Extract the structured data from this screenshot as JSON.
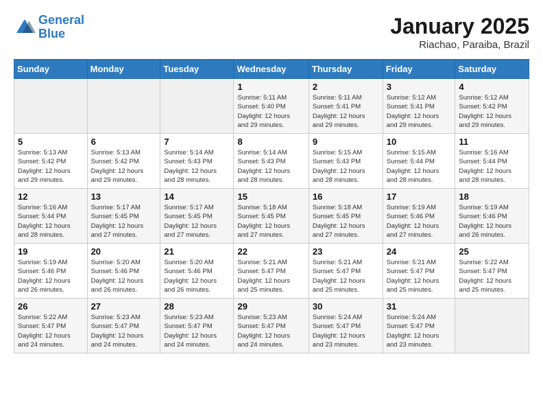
{
  "header": {
    "logo_line1": "General",
    "logo_line2": "Blue",
    "title": "January 2025",
    "subtitle": "Riachao, Paraiba, Brazil"
  },
  "days_of_week": [
    "Sunday",
    "Monday",
    "Tuesday",
    "Wednesday",
    "Thursday",
    "Friday",
    "Saturday"
  ],
  "weeks": [
    [
      {
        "day": "",
        "info": ""
      },
      {
        "day": "",
        "info": ""
      },
      {
        "day": "",
        "info": ""
      },
      {
        "day": "1",
        "info": "Sunrise: 5:11 AM\nSunset: 5:40 PM\nDaylight: 12 hours\nand 29 minutes."
      },
      {
        "day": "2",
        "info": "Sunrise: 5:11 AM\nSunset: 5:41 PM\nDaylight: 12 hours\nand 29 minutes."
      },
      {
        "day": "3",
        "info": "Sunrise: 5:12 AM\nSunset: 5:41 PM\nDaylight: 12 hours\nand 29 minutes."
      },
      {
        "day": "4",
        "info": "Sunrise: 5:12 AM\nSunset: 5:42 PM\nDaylight: 12 hours\nand 29 minutes."
      }
    ],
    [
      {
        "day": "5",
        "info": "Sunrise: 5:13 AM\nSunset: 5:42 PM\nDaylight: 12 hours\nand 29 minutes."
      },
      {
        "day": "6",
        "info": "Sunrise: 5:13 AM\nSunset: 5:42 PM\nDaylight: 12 hours\nand 29 minutes."
      },
      {
        "day": "7",
        "info": "Sunrise: 5:14 AM\nSunset: 5:43 PM\nDaylight: 12 hours\nand 28 minutes."
      },
      {
        "day": "8",
        "info": "Sunrise: 5:14 AM\nSunset: 5:43 PM\nDaylight: 12 hours\nand 28 minutes."
      },
      {
        "day": "9",
        "info": "Sunrise: 5:15 AM\nSunset: 5:43 PM\nDaylight: 12 hours\nand 28 minutes."
      },
      {
        "day": "10",
        "info": "Sunrise: 5:15 AM\nSunset: 5:44 PM\nDaylight: 12 hours\nand 28 minutes."
      },
      {
        "day": "11",
        "info": "Sunrise: 5:16 AM\nSunset: 5:44 PM\nDaylight: 12 hours\nand 28 minutes."
      }
    ],
    [
      {
        "day": "12",
        "info": "Sunrise: 5:16 AM\nSunset: 5:44 PM\nDaylight: 12 hours\nand 28 minutes."
      },
      {
        "day": "13",
        "info": "Sunrise: 5:17 AM\nSunset: 5:45 PM\nDaylight: 12 hours\nand 27 minutes."
      },
      {
        "day": "14",
        "info": "Sunrise: 5:17 AM\nSunset: 5:45 PM\nDaylight: 12 hours\nand 27 minutes."
      },
      {
        "day": "15",
        "info": "Sunrise: 5:18 AM\nSunset: 5:45 PM\nDaylight: 12 hours\nand 27 minutes."
      },
      {
        "day": "16",
        "info": "Sunrise: 5:18 AM\nSunset: 5:45 PM\nDaylight: 12 hours\nand 27 minutes."
      },
      {
        "day": "17",
        "info": "Sunrise: 5:19 AM\nSunset: 5:46 PM\nDaylight: 12 hours\nand 27 minutes."
      },
      {
        "day": "18",
        "info": "Sunrise: 5:19 AM\nSunset: 5:46 PM\nDaylight: 12 hours\nand 26 minutes."
      }
    ],
    [
      {
        "day": "19",
        "info": "Sunrise: 5:19 AM\nSunset: 5:46 PM\nDaylight: 12 hours\nand 26 minutes."
      },
      {
        "day": "20",
        "info": "Sunrise: 5:20 AM\nSunset: 5:46 PM\nDaylight: 12 hours\nand 26 minutes."
      },
      {
        "day": "21",
        "info": "Sunrise: 5:20 AM\nSunset: 5:46 PM\nDaylight: 12 hours\nand 26 minutes."
      },
      {
        "day": "22",
        "info": "Sunrise: 5:21 AM\nSunset: 5:47 PM\nDaylight: 12 hours\nand 25 minutes."
      },
      {
        "day": "23",
        "info": "Sunrise: 5:21 AM\nSunset: 5:47 PM\nDaylight: 12 hours\nand 25 minutes."
      },
      {
        "day": "24",
        "info": "Sunrise: 5:21 AM\nSunset: 5:47 PM\nDaylight: 12 hours\nand 25 minutes."
      },
      {
        "day": "25",
        "info": "Sunrise: 5:22 AM\nSunset: 5:47 PM\nDaylight: 12 hours\nand 25 minutes."
      }
    ],
    [
      {
        "day": "26",
        "info": "Sunrise: 5:22 AM\nSunset: 5:47 PM\nDaylight: 12 hours\nand 24 minutes."
      },
      {
        "day": "27",
        "info": "Sunrise: 5:23 AM\nSunset: 5:47 PM\nDaylight: 12 hours\nand 24 minutes."
      },
      {
        "day": "28",
        "info": "Sunrise: 5:23 AM\nSunset: 5:47 PM\nDaylight: 12 hours\nand 24 minutes."
      },
      {
        "day": "29",
        "info": "Sunrise: 5:23 AM\nSunset: 5:47 PM\nDaylight: 12 hours\nand 24 minutes."
      },
      {
        "day": "30",
        "info": "Sunrise: 5:24 AM\nSunset: 5:47 PM\nDaylight: 12 hours\nand 23 minutes."
      },
      {
        "day": "31",
        "info": "Sunrise: 5:24 AM\nSunset: 5:47 PM\nDaylight: 12 hours\nand 23 minutes."
      },
      {
        "day": "",
        "info": ""
      }
    ]
  ]
}
